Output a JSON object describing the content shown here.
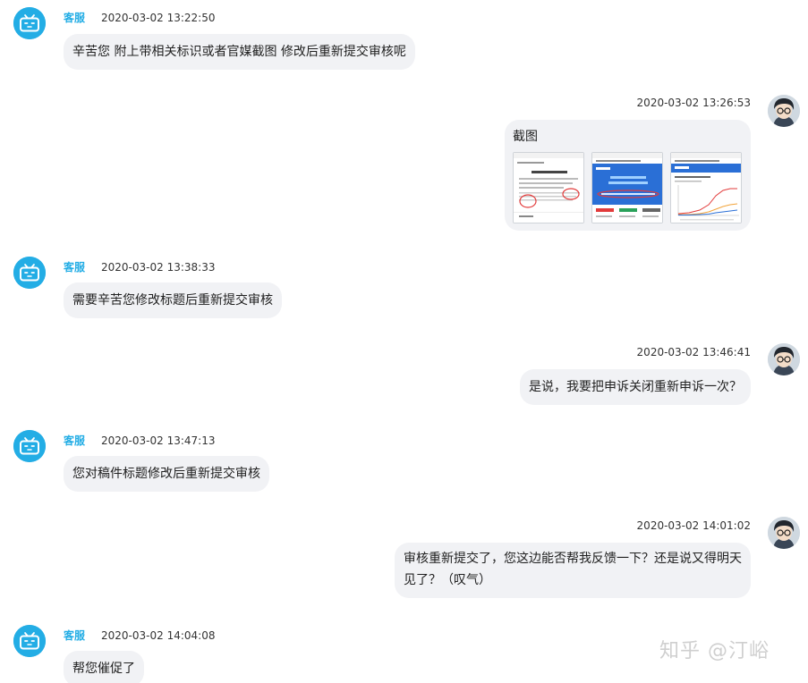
{
  "messages": [
    {
      "side": "left",
      "name": "客服",
      "time": "2020-03-02 13:22:50",
      "text": "辛苦您 附上带相关标识或者官媒截图 修改后重新提交审核呢"
    },
    {
      "side": "right",
      "time": "2020-03-02 13:26:53",
      "text": "截图"
    },
    {
      "side": "left",
      "name": "客服",
      "time": "2020-03-02 13:38:33",
      "text": "需要辛苦您修改标题后重新提交审核"
    },
    {
      "side": "right",
      "time": "2020-03-02 13:46:41",
      "text": "是说，我要把申诉关闭重新申诉一次？"
    },
    {
      "side": "left",
      "name": "客服",
      "time": "2020-03-02 13:47:13",
      "text": "您对稿件标题修改后重新提交审核"
    },
    {
      "side": "right",
      "time": "2020-03-02 14:01:02",
      "text_line1": "审核重新提交了，您这边能否帮我反馈一下？还是说又得明天",
      "text_line2": "见了？（叹气）"
    },
    {
      "side": "left",
      "name": "客服",
      "time": "2020-03-02 14:04:08",
      "text": "帮您催促了"
    }
  ],
  "watermark": "知乎 @汀峪",
  "colors": {
    "accent": "#23ade5",
    "bubble": "#f1f2f5",
    "annotation": "#e23b3b",
    "screenshot_blue": "#2a6fd6"
  }
}
